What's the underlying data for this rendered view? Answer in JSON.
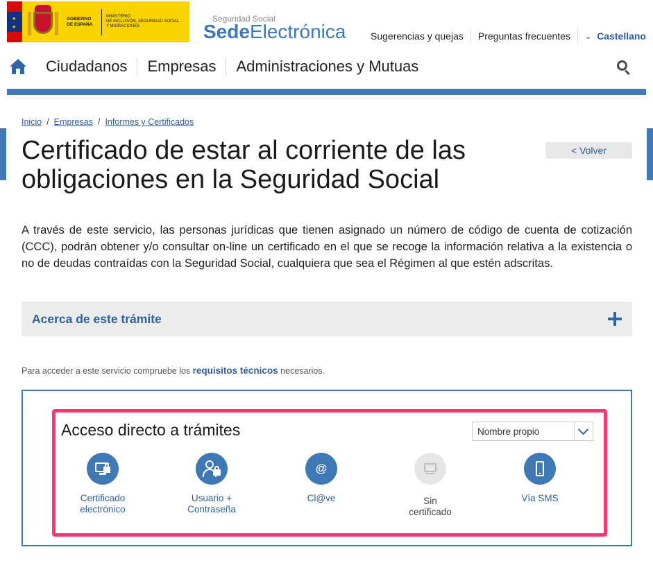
{
  "header": {
    "gov_line1": "GOBIERNO",
    "gov_line2": "DE ESPAÑA",
    "ministry_line1": "MINISTERIO",
    "ministry_line2": "DE INCLUSIÓN, SEGURIDAD SOCIAL",
    "ministry_line3": "Y MIGRACIONES",
    "sede_small": "Seguridad Social",
    "sede_bold": "Sede",
    "sede_light": "Electrónica",
    "links": {
      "suggestions": "Sugerencias y quejas",
      "faq": "Preguntas frecuentes",
      "language": "Castellano"
    }
  },
  "nav": {
    "items": [
      "Ciudadanos",
      "Empresas",
      "Administraciones y Mutuas"
    ]
  },
  "breadcrumb": {
    "items": [
      "Inicio",
      "Empresas",
      "Informes y Certificados"
    ],
    "separator": "/"
  },
  "page": {
    "title": "Certificado de estar al corriente de las obligaciones en la Seguridad Social",
    "back_label": "< Volver",
    "intro": "A través de este servicio, las personas jurídicas que tienen asignado un número de código de cuenta de cotización (CCC), podrán obtener y/o consultar on-line un certificado en el que se recoge la información relativa a la existencia o no de deudas contraídas con la Seguridad Social, cualquiera que sea el Régimen al que estén adscritas."
  },
  "accordion": {
    "title": "Acerca de este trámite"
  },
  "requirements": {
    "prefix": "Para acceder a este servicio compruebe los ",
    "link": "requisitos técnicos",
    "suffix": " necesarios."
  },
  "access": {
    "title": "Acceso directo a trámites",
    "select_value": "Nombre propio",
    "methods": [
      {
        "label_1": "Certificado",
        "label_2": "electrónico",
        "icon": "certificate-icon",
        "enabled": true
      },
      {
        "label_1": "Usuario +",
        "label_2": "Contraseña",
        "icon": "user-password-icon",
        "enabled": true
      },
      {
        "label_1": "Cl@ve",
        "label_2": "",
        "icon": "clave-icon",
        "enabled": true
      },
      {
        "label_1": "Sin",
        "label_2": "certificado",
        "icon": "no-certificate-icon",
        "enabled": false
      },
      {
        "label_1": "Vía SMS",
        "label_2": "",
        "icon": "sms-icon",
        "enabled": true
      }
    ]
  },
  "colors": {
    "brand_blue": "#3e78b5",
    "link_blue": "#2e5f9a",
    "highlight_pink": "#f33a73",
    "gov_yellow": "#fbd300"
  }
}
